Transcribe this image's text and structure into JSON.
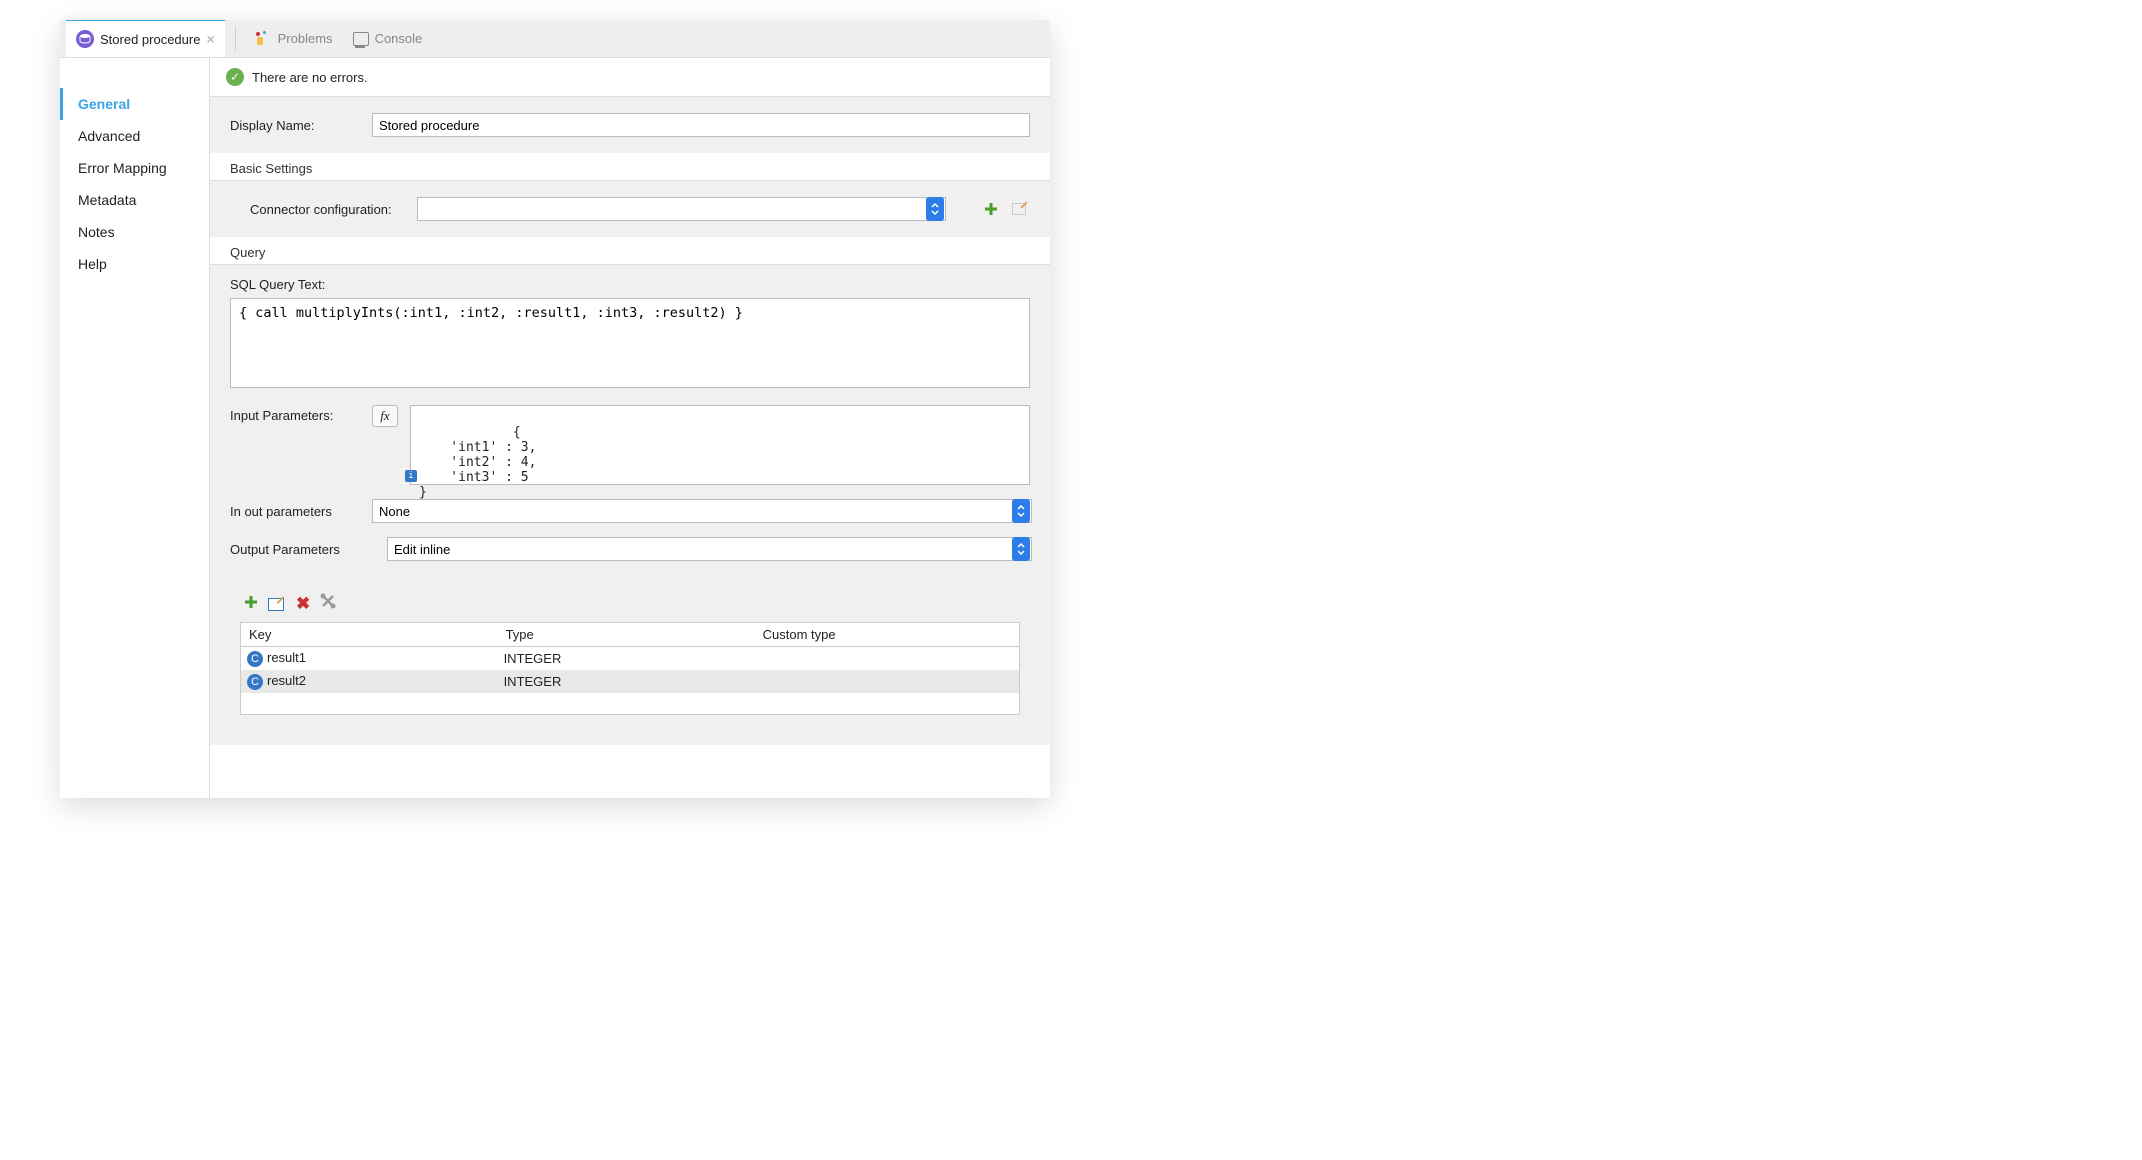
{
  "tabs": {
    "active": {
      "label": "Stored procedure"
    },
    "problems": {
      "label": "Problems"
    },
    "console": {
      "label": "Console"
    }
  },
  "sidebar": {
    "items": [
      "General",
      "Advanced",
      "Error Mapping",
      "Metadata",
      "Notes",
      "Help"
    ]
  },
  "status": {
    "message": "There are no errors."
  },
  "form": {
    "displayName": {
      "label": "Display Name:",
      "value": "Stored procedure"
    },
    "basicSettingsTitle": "Basic Settings",
    "connectorConfig": {
      "label": "Connector configuration:",
      "value": ""
    },
    "queryTitle": "Query",
    "sqlQueryLabel": "SQL Query Text:",
    "sqlQueryText": "{ call multiplyInts(:int1, :int2, :result1, :int3, :result2) }",
    "inputParamsLabel": "Input Parameters:",
    "inputParamsText": "{\n    'int1' : 3,\n    'int2' : 4,\n    'int3' : 5\n}",
    "inOutParamsLabel": "In out parameters",
    "inOutParamsValue": "None",
    "outputParamsLabel": "Output Parameters",
    "outputParamsValue": "Edit inline",
    "tableHeaders": {
      "key": "Key",
      "type": "Type",
      "custom": "Custom type"
    },
    "tableRows": [
      {
        "key": "result1",
        "type": "INTEGER",
        "custom": ""
      },
      {
        "key": "result2",
        "type": "INTEGER",
        "custom": ""
      }
    ]
  }
}
